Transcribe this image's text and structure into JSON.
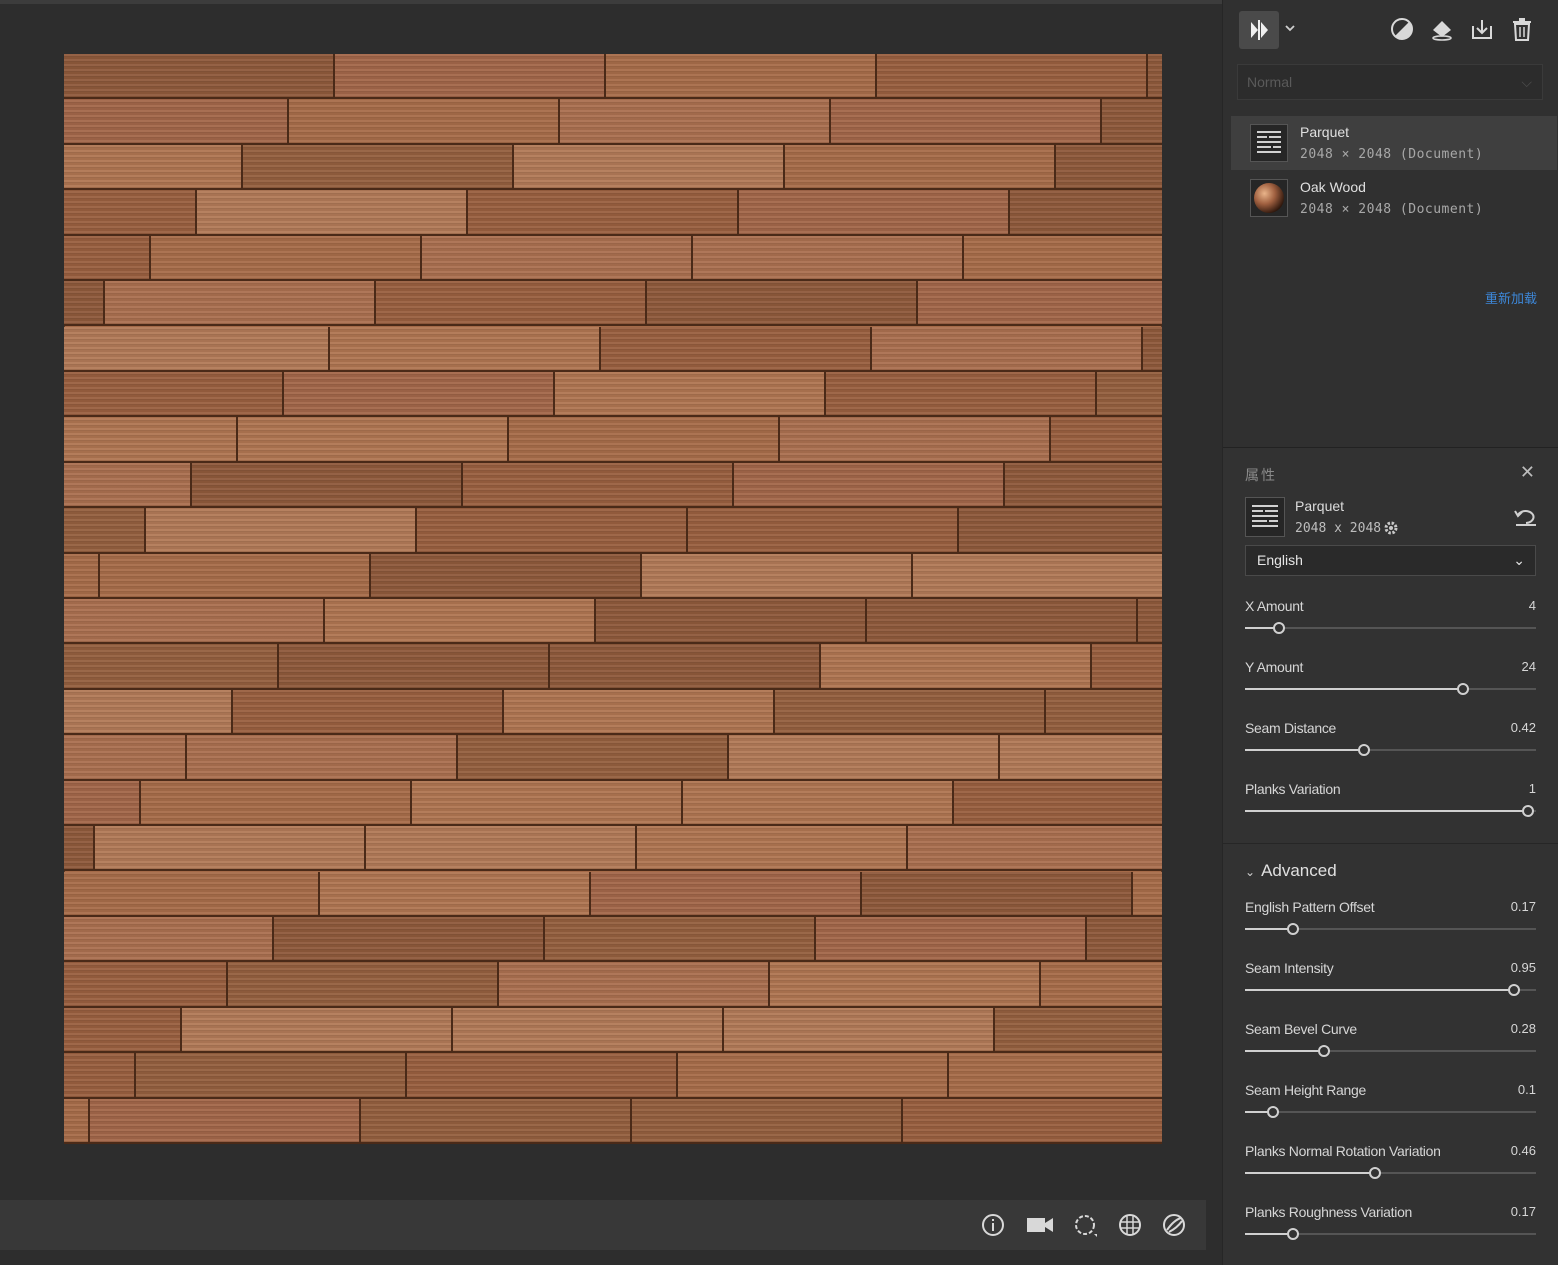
{
  "viewport": {
    "wood_color": "#a46a48",
    "toolbar_icons": [
      "info-icon",
      "camera-icon",
      "environment-icon",
      "grid-icon",
      "material-sphere-icon"
    ]
  },
  "toolbar": {
    "icons": [
      "split-view-icon",
      "chevron-down-icon",
      "mask-icon",
      "fill-icon",
      "export-icon",
      "trash-icon"
    ]
  },
  "layers": {
    "blend_mode": "Normal",
    "items": [
      {
        "name": "Parquet",
        "size": "2048 × 2048 (Document)",
        "selected": true
      },
      {
        "name": "Oak Wood",
        "size": "2048 × 2048 (Document)",
        "selected": false
      }
    ],
    "reload_label": "重新加载"
  },
  "properties": {
    "title": "属性",
    "name": "Parquet",
    "size": "2048 x 2048",
    "pattern": "English",
    "sliders": [
      {
        "label": "X Amount",
        "value": "4",
        "fraction": 0.12
      },
      {
        "label": "Y Amount",
        "value": "24",
        "fraction": 0.77
      },
      {
        "label": "Seam Distance",
        "value": "0.42",
        "fraction": 0.42
      },
      {
        "label": "Planks Variation",
        "value": "1",
        "fraction": 1.0
      }
    ],
    "advanced_label": "Advanced",
    "advanced_sliders": [
      {
        "label": "English Pattern Offset",
        "value": "0.17",
        "fraction": 0.17
      },
      {
        "label": "Seam Intensity",
        "value": "0.95",
        "fraction": 0.95
      },
      {
        "label": "Seam Bevel Curve",
        "value": "0.28",
        "fraction": 0.28
      },
      {
        "label": "Seam Height Range",
        "value": "0.1",
        "fraction": 0.1
      },
      {
        "label": "Planks Normal Rotation Variation",
        "value": "0.46",
        "fraction": 0.46
      },
      {
        "label": "Planks Roughness Variation",
        "value": "0.17",
        "fraction": 0.17
      }
    ]
  }
}
